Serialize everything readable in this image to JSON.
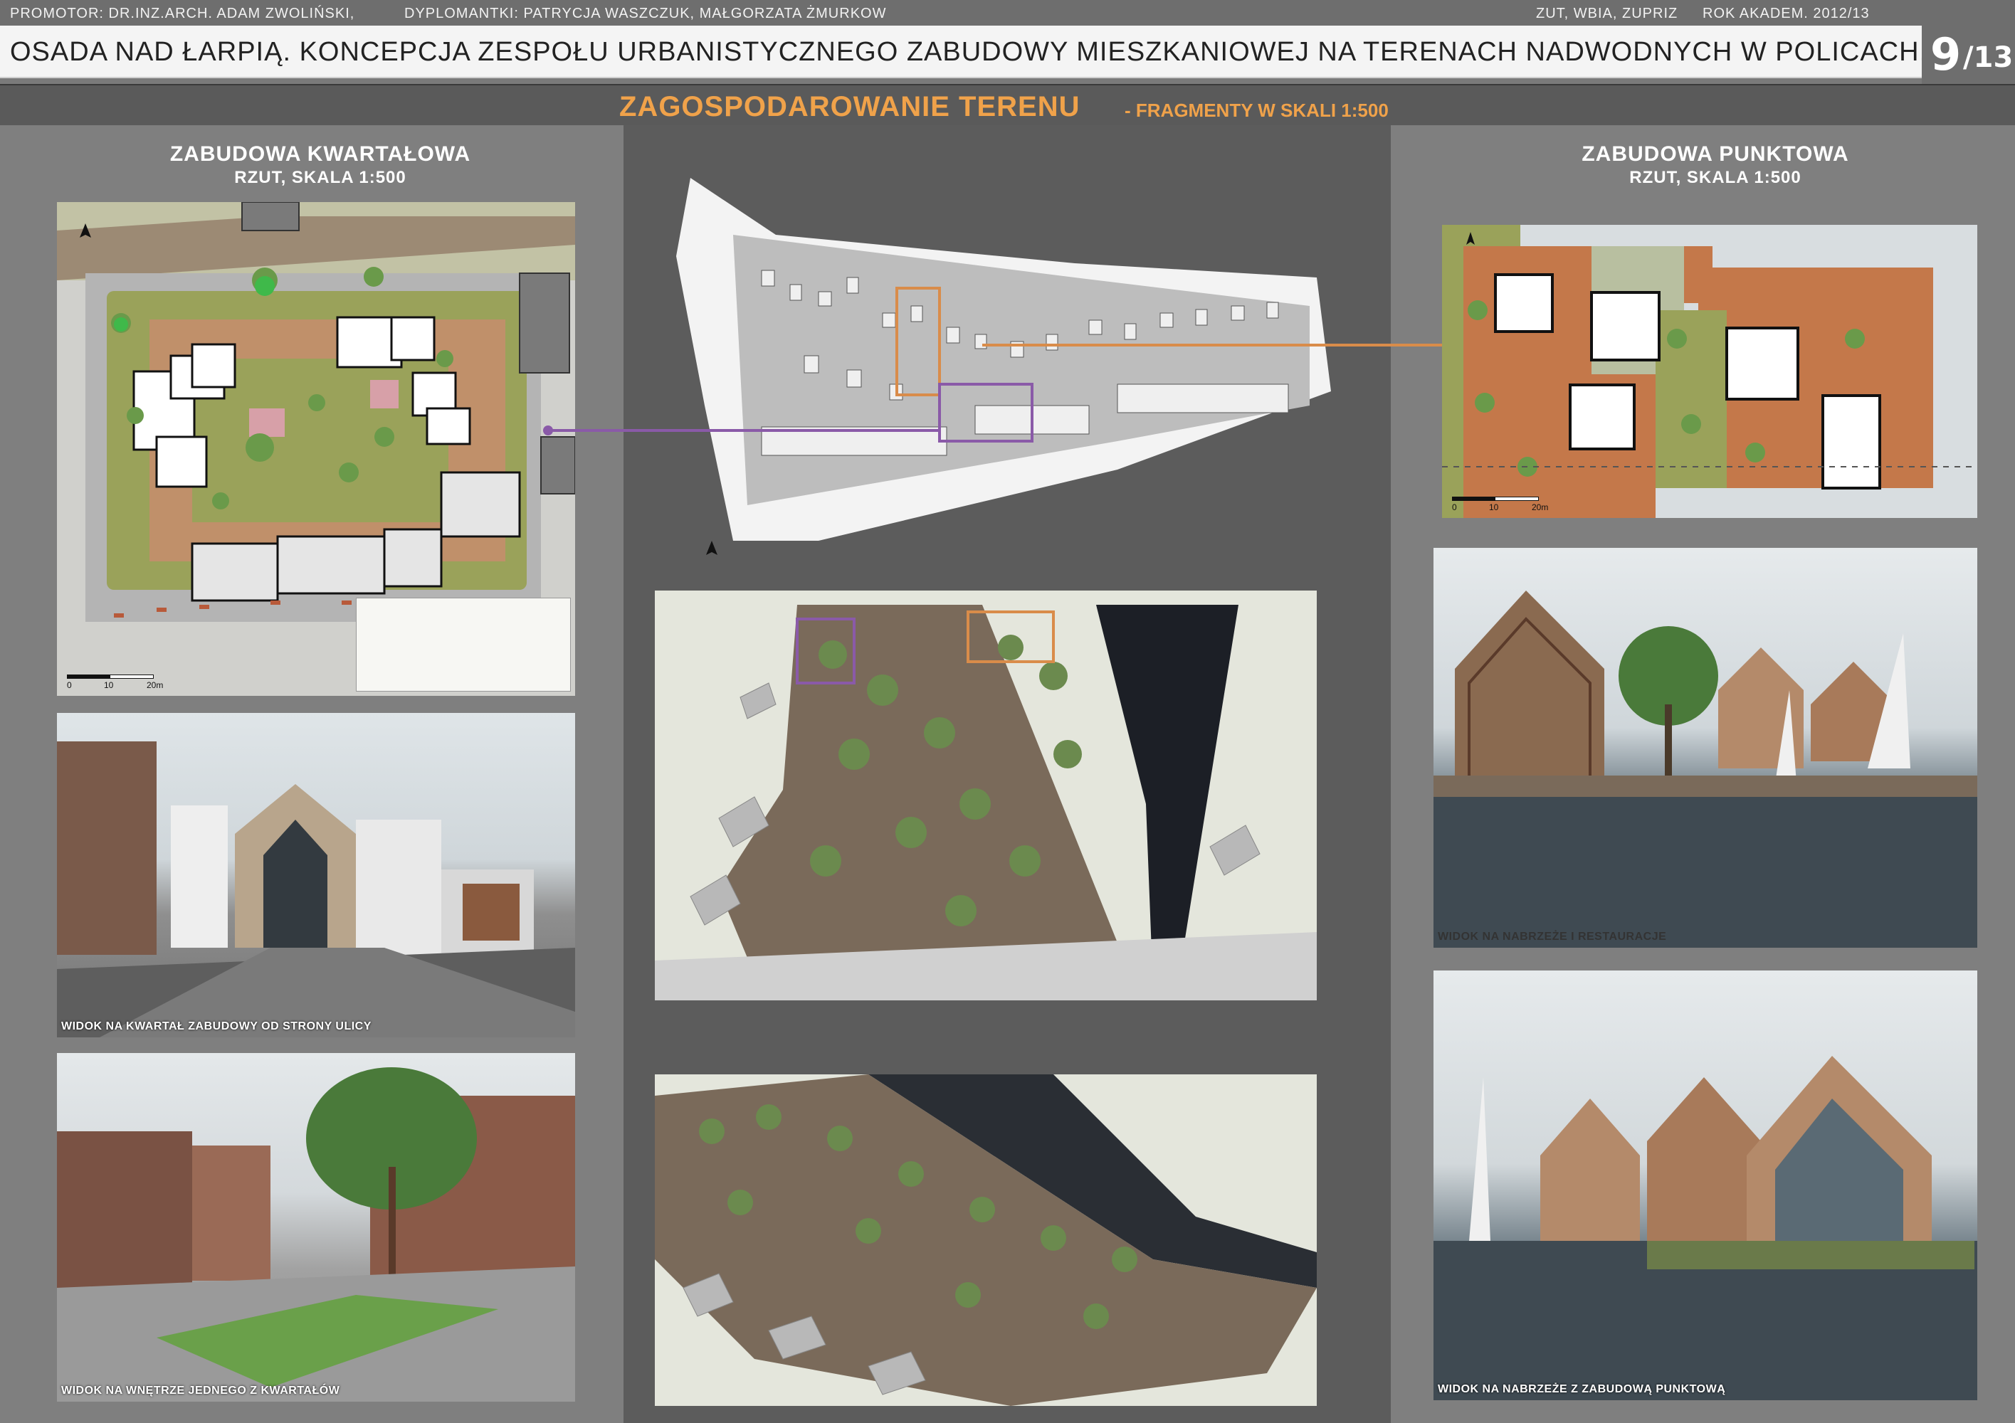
{
  "header": {
    "promotor": "PROMOTOR: DR.INZ.ARCH. ADAM ZWOLIŃSKI,",
    "dyplomantki": "DYPLOMANTKI: PATRYCJA WASZCZUK, MAŁGORZATA ŻMURKOW",
    "uczelnia": "ZUT, WBIA, ZUPRIZ",
    "rok": "ROK AKADEM.  2012/13",
    "title": "OSADA NAD ŁARPIĄ. KONCEPCJA ZESPOŁU  URBANISTYCZNEGO  ZABUDOWY MIESZKANIOWEJ NA TERENACH NADWODNYCH W POLICACH.",
    "page_current": "9",
    "page_total": "/13"
  },
  "subtitle": {
    "main": "ZAGOSPODAROWANIE TERENU",
    "sub": "- FRAGMENTY W SKALI 1:500"
  },
  "left": {
    "heading": "ZABUDOWA KWARTAŁOWA",
    "subheading": "RZUT,  SKALA 1:500",
    "scale": {
      "a": "0",
      "b": "10",
      "c": "20m"
    },
    "caption_street": "WIDOK NA KWARTAŁ ZABUDOWY OD STRONY ULICY",
    "caption_inner": "WIDOK NA WNĘTRZE JEDNEGO Z KWARTAŁÓW"
  },
  "right": {
    "heading": "ZABUDOWA PUNKTOWA",
    "subheading": "RZUT,  SKALA 1:500",
    "scale": {
      "a": "0",
      "b": "10",
      "c": "20m"
    },
    "caption_quay": "WIDOK NA NABRZEŻE I RESTAURACJE",
    "caption_points": "WIDOK NA NABRZEŻE Z ZABUDOWĄ PUNKTOWĄ"
  },
  "colors": {
    "accent_orange": "#f0a24a",
    "link_purple": "#8a5aa8",
    "link_orange": "#d98c4a"
  }
}
